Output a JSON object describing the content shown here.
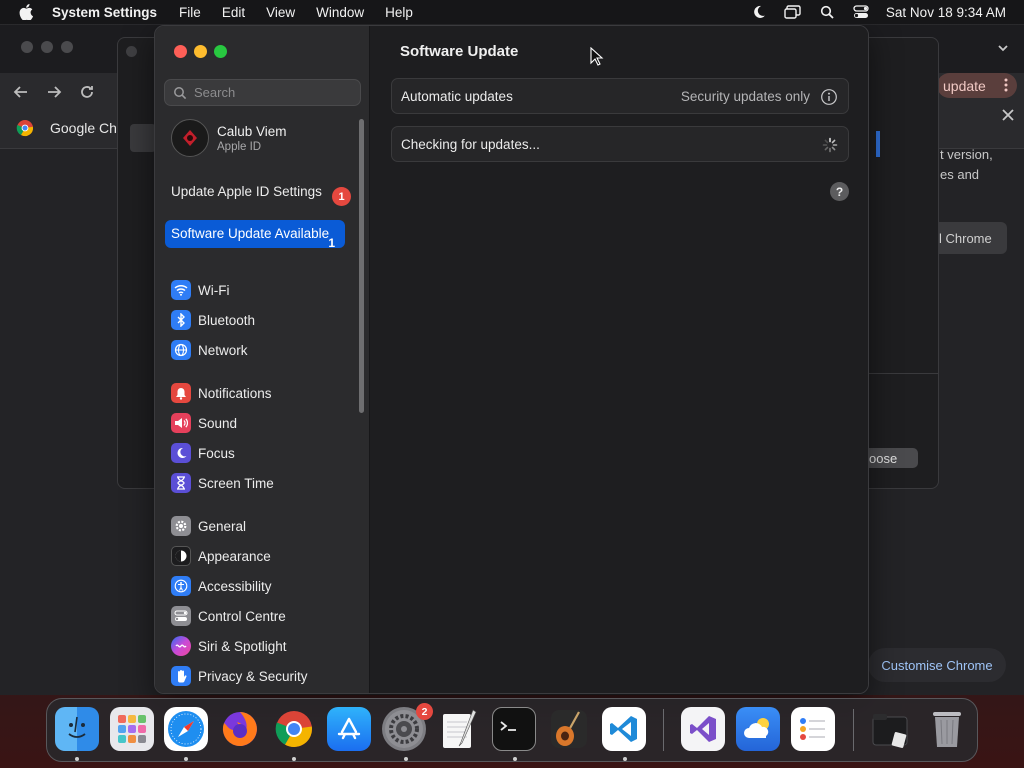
{
  "menubar": {
    "app_name": "System Settings",
    "items": [
      "File",
      "Edit",
      "View",
      "Window",
      "Help"
    ],
    "clock": "Sat Nov 18  9:34 AM"
  },
  "chrome_background": {
    "bookmark_label": "Google Ch",
    "update_pill": "update",
    "panel_text_line1": "t version,",
    "panel_text_line2": "es and",
    "reinstall_button": "l Chrome",
    "customise_button": "Customise Chrome"
  },
  "back_dialog": {
    "choose_button": "oose"
  },
  "sidebar": {
    "search_placeholder": "Search",
    "account_name": "Calub Viem",
    "account_sub": "Apple ID",
    "notice_apple_id": "Update Apple ID Settings",
    "notice_apple_id_badge": "1",
    "notice_software_update": "Software Update Available",
    "notice_software_update_count": "1",
    "items": [
      {
        "label": "Wi-Fi",
        "icon": "wifi-icon",
        "color": "#2f7df6"
      },
      {
        "label": "Bluetooth",
        "icon": "bluetooth-icon",
        "color": "#2f7df6"
      },
      {
        "label": "Network",
        "icon": "globe-icon",
        "color": "#2f7df6"
      },
      {
        "label": "Notifications",
        "icon": "bell-icon",
        "color": "#e5483f"
      },
      {
        "label": "Sound",
        "icon": "speaker-icon",
        "color": "#e5405b"
      },
      {
        "label": "Focus",
        "icon": "moon-icon",
        "color": "#5b4fd6"
      },
      {
        "label": "Screen Time",
        "icon": "hourglass-icon",
        "color": "#5b4fd6"
      },
      {
        "label": "General",
        "icon": "gear-icon",
        "color": "#8e8e93"
      },
      {
        "label": "Appearance",
        "icon": "appearance-icon",
        "color": "#1c1c1e"
      },
      {
        "label": "Accessibility",
        "icon": "accessibility-icon",
        "color": "#2f7df6"
      },
      {
        "label": "Control Centre",
        "icon": "control-centre-icon",
        "color": "#8e8e93"
      },
      {
        "label": "Siri & Spotlight",
        "icon": "siri-icon",
        "color": "#b04ad8"
      },
      {
        "label": "Privacy & Security",
        "icon": "hand-icon",
        "color": "#2f7df6"
      }
    ]
  },
  "content": {
    "title": "Software Update",
    "automatic_updates_label": "Automatic updates",
    "automatic_updates_value": "Security updates only",
    "checking_label": "Checking for updates...",
    "help_label": "?"
  },
  "dock": {
    "settings_badge": "2",
    "apps": [
      "Finder",
      "Launchpad",
      "Safari",
      "Firefox",
      "Google Chrome",
      "App Store",
      "System Settings",
      "TextEdit",
      "Terminal",
      "GarageBand",
      "Visual Studio Code",
      "Visual Studio",
      "Weather",
      "Reminders",
      "Downloads",
      "Trash"
    ]
  }
}
